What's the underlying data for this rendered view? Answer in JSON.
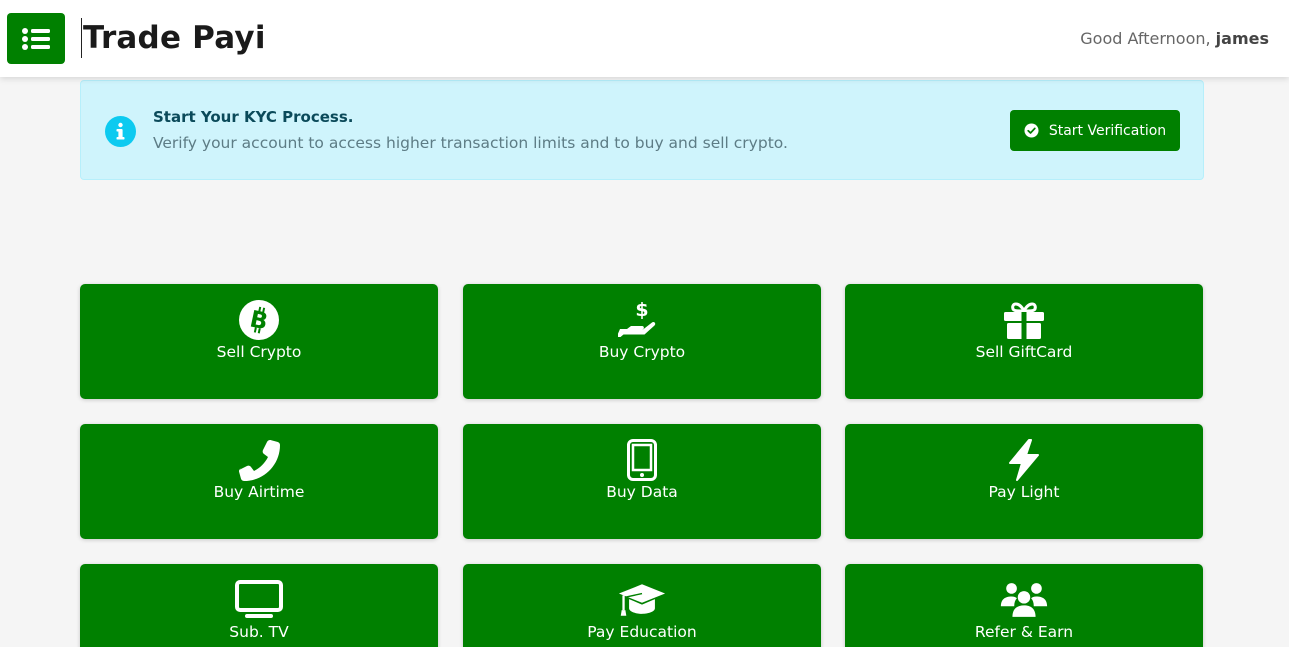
{
  "header": {
    "brand": "Trade Payi",
    "greeting_prefix": "Good Afternoon, ",
    "username": "james"
  },
  "kyc": {
    "title": "Start Your KYC Process.",
    "subtitle": "Verify your account to access higher transaction limits and to buy and sell crypto.",
    "button_label": "Start Verification"
  },
  "tiles": [
    {
      "label": "Sell Crypto",
      "icon": "bitcoin-icon"
    },
    {
      "label": "Buy Crypto",
      "icon": "hand-dollar-icon"
    },
    {
      "label": "Sell GiftCard",
      "icon": "gift-icon"
    },
    {
      "label": "Buy Airtime",
      "icon": "phone-icon"
    },
    {
      "label": "Buy Data",
      "icon": "mobile-icon"
    },
    {
      "label": "Pay Light",
      "icon": "bolt-icon"
    },
    {
      "label": "Sub. TV",
      "icon": "tv-icon"
    },
    {
      "label": "Pay Education",
      "icon": "graduation-cap-icon"
    },
    {
      "label": "Refer & Earn",
      "icon": "users-icon"
    }
  ],
  "colors": {
    "primary_green": "#008000",
    "kyc_background": "#cff4fc",
    "info_icon": "#0dcaf0"
  }
}
